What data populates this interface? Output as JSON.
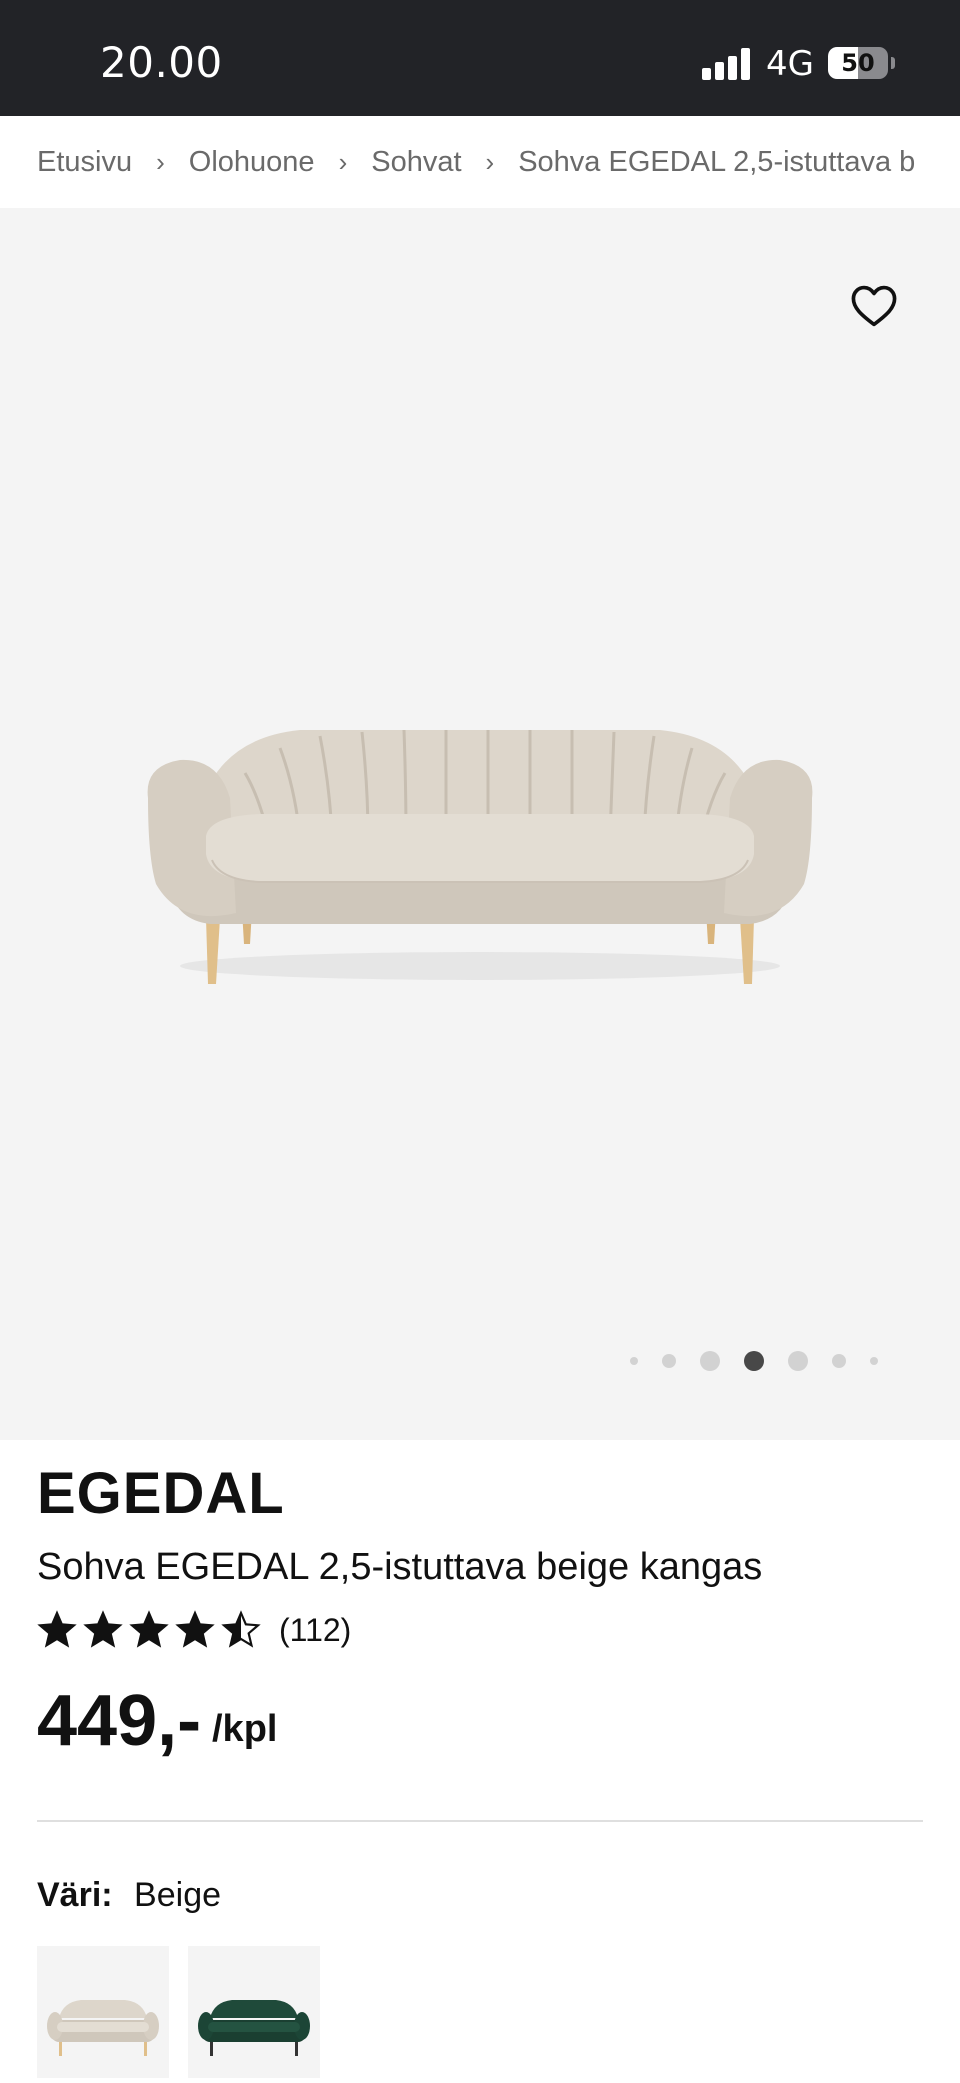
{
  "status_bar": {
    "time": "20.00",
    "network": "4G",
    "battery_percent": "50",
    "signal_icon": "cellular-signal-icon",
    "battery_icon": "battery-icon"
  },
  "breadcrumb": {
    "items": [
      "Etusivu",
      "Olohuone",
      "Sohvat",
      "Sohva EGEDAL 2,5-istuttava b"
    ],
    "separator": "›"
  },
  "gallery": {
    "favorite_icon": "heart-icon",
    "image_subject": "beige-sofa",
    "slide_count": 7,
    "active_slide_index": 3
  },
  "product": {
    "name": "EGEDAL",
    "description": "Sohva EGEDAL 2,5-istuttava beige kangas",
    "rating": 4.5,
    "rating_max": 5,
    "review_count": "(112)",
    "price": "449,-",
    "unit": "/kpl"
  },
  "color": {
    "label": "Väri:",
    "selected": "Beige",
    "swatches": [
      "beige",
      "green"
    ]
  },
  "colors": {
    "status_bar_bg": "#222327",
    "gallery_bg": "#f4f4f4",
    "text": "#111111",
    "breadcrumb_text": "#6a6a6a",
    "sofa_beige": "#d9d2c8",
    "sofa_green": "#1f4a3a",
    "sofa_legs": "#e0bf8a"
  }
}
